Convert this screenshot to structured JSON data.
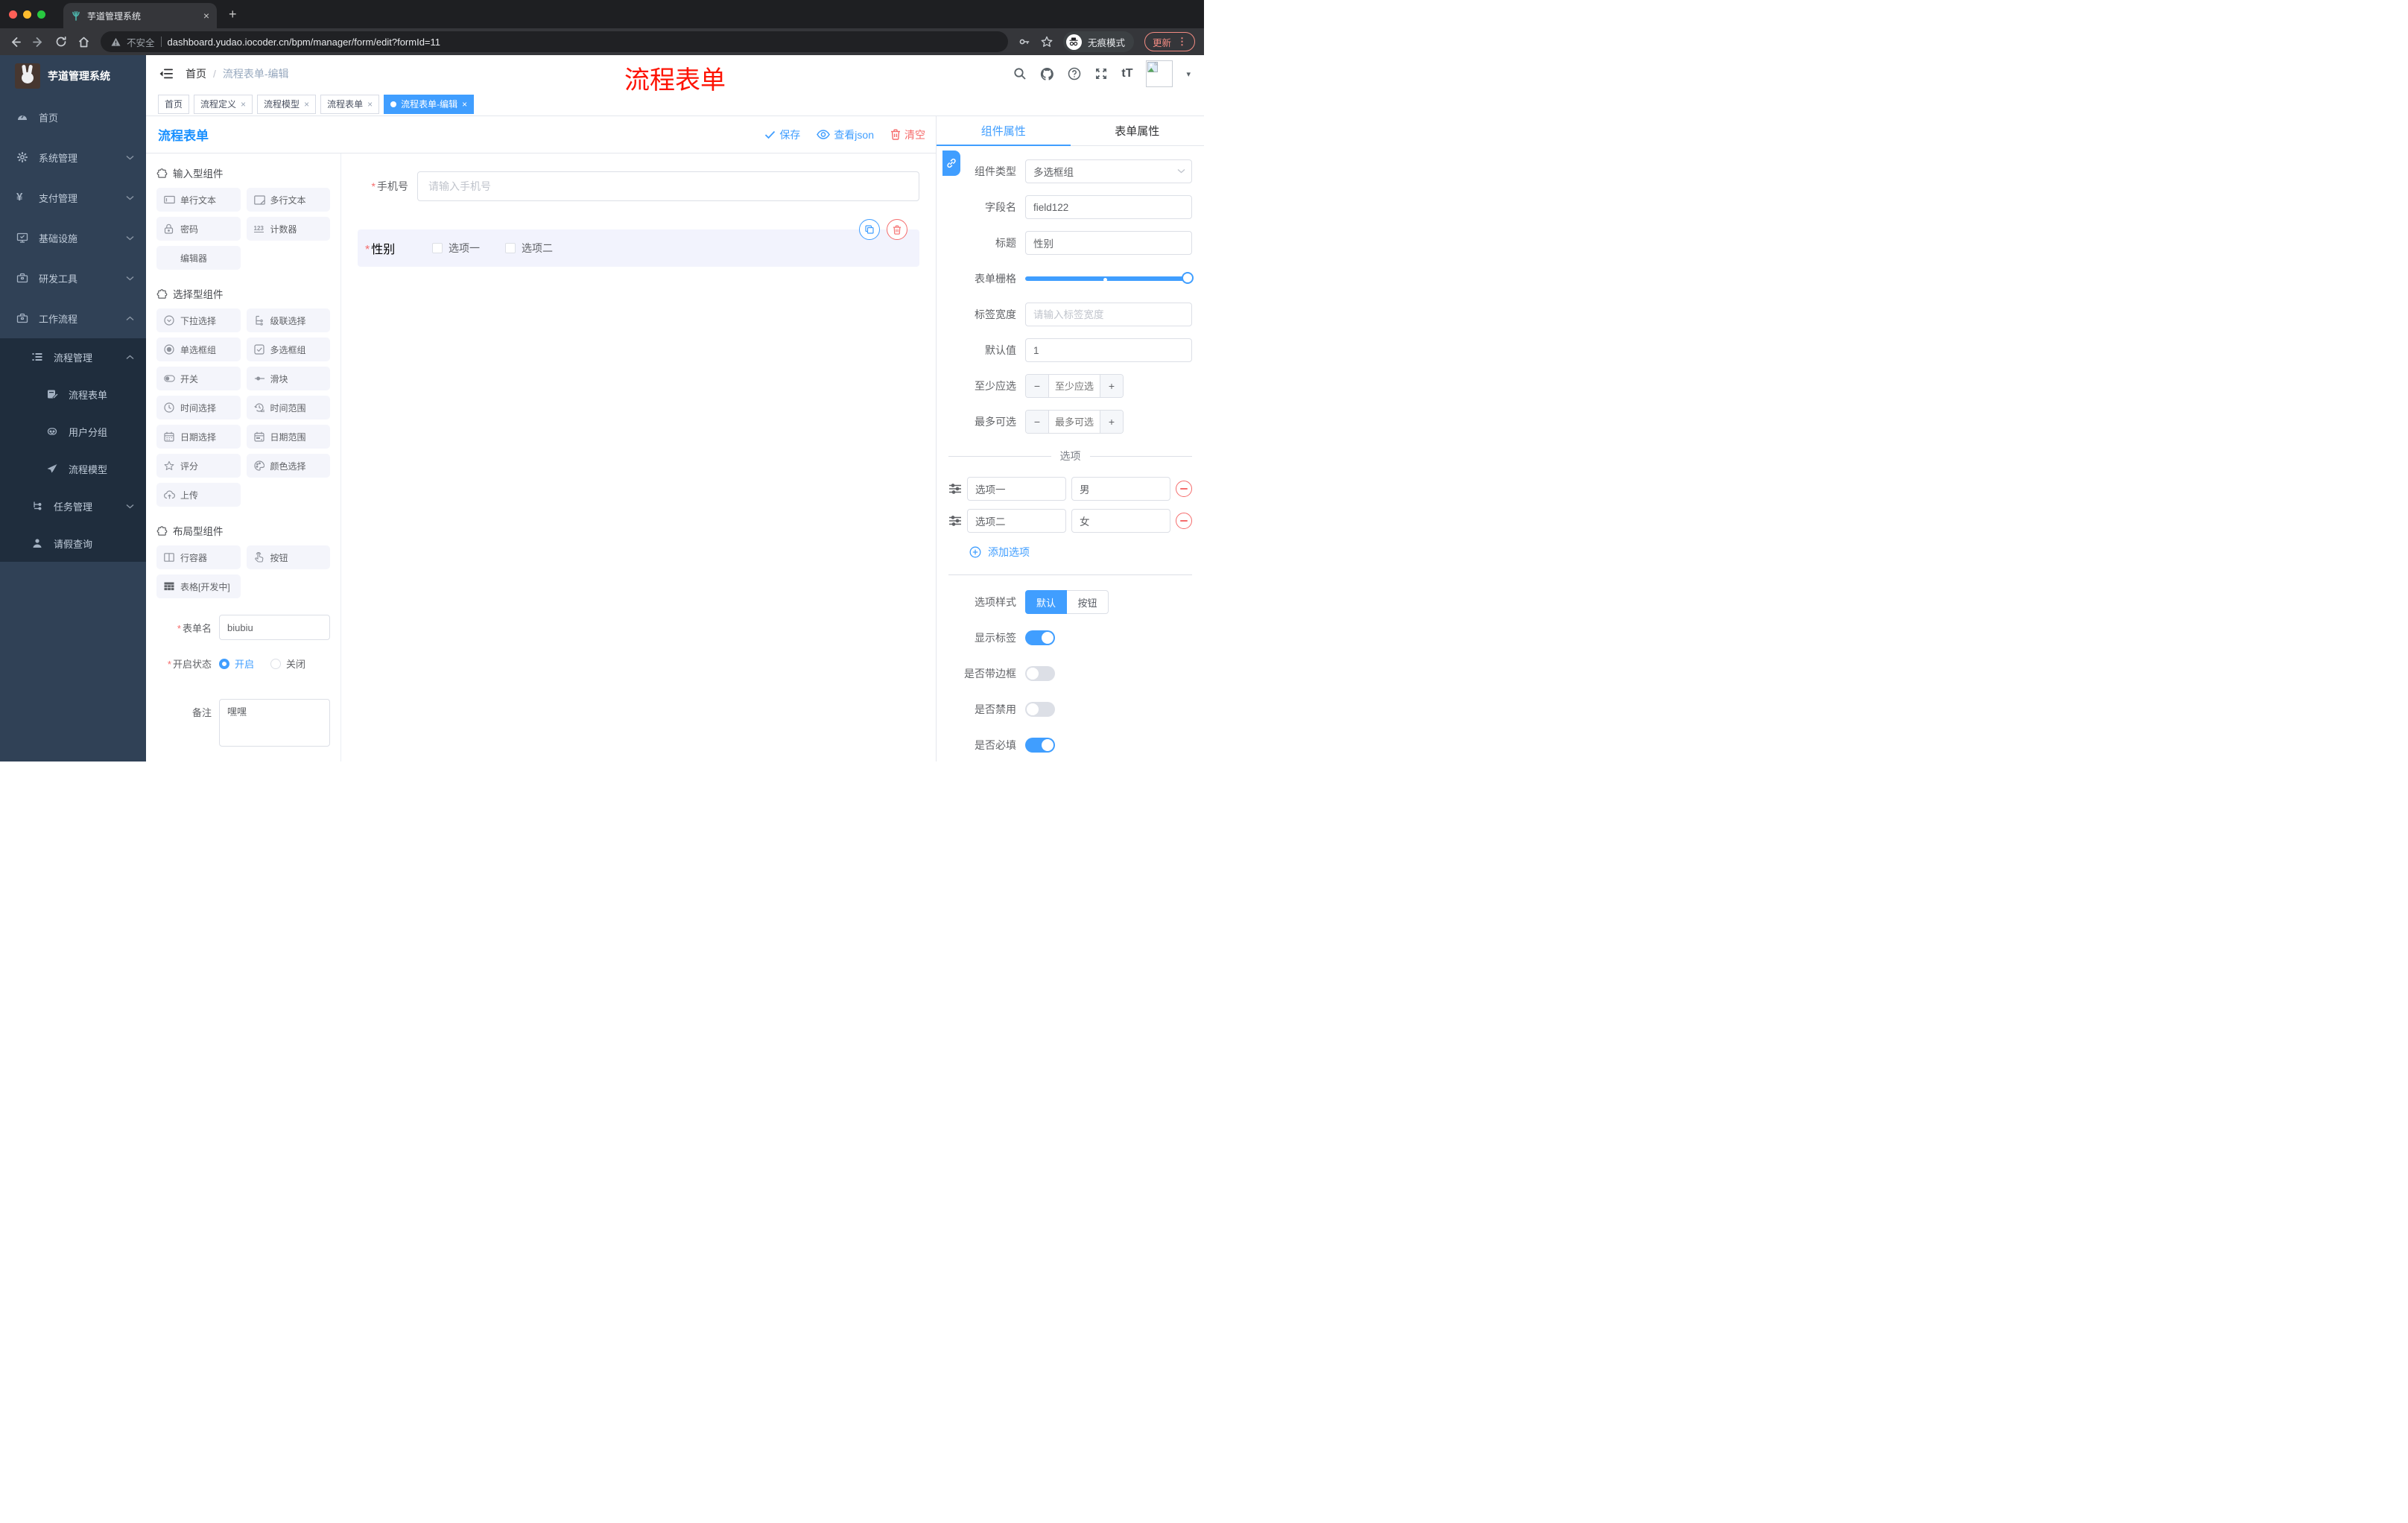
{
  "icons": {
    "close": "×",
    "plus": "+",
    "minus": "−",
    "kebab": "⋮",
    "caret": "▾",
    "sep": "/",
    "required": "*",
    "newtab": "+",
    "font_size": "tT",
    "counter": "123"
  },
  "colors": {
    "accent": "#409eff",
    "danger": "#f56c6c",
    "designer_title_blue": "#1890ff",
    "annotation_red": "#fd1303",
    "sidebar_bg": "#304156",
    "submenu_bg": "#1f2d3d",
    "chrome_dark": "#1e1f22",
    "toolbar_dark": "#35363a",
    "update_salmon": "#f28b82",
    "palette_item_bg": "#f4f5fb",
    "selected_item_bg": "#f2f3fd"
  },
  "browser": {
    "tab_title": "芋道管理系统",
    "security_label": "不安全",
    "url": "dashboard.yudao.iocoder.cn/bpm/manager/form/edit?formId=11",
    "incognito_label": "无痕模式",
    "update_label": "更新"
  },
  "sidebar": {
    "logo_title": "芋道管理系统",
    "items": [
      {
        "label": "首页",
        "icon": "dashboard-icon"
      },
      {
        "label": "系统管理",
        "icon": "gear-icon",
        "chevron": "down"
      },
      {
        "label": "支付管理",
        "icon": "yen-icon",
        "chevron": "down"
      },
      {
        "label": "基础设施",
        "icon": "monitor-icon",
        "chevron": "down"
      },
      {
        "label": "研发工具",
        "icon": "toolbox-icon",
        "chevron": "down"
      },
      {
        "label": "工作流程",
        "icon": "toolbox-icon",
        "chevron": "up"
      }
    ],
    "submenu": [
      {
        "label": "流程管理",
        "icon": "list-tree-icon",
        "chevron": "up",
        "level": 2
      },
      {
        "label": "流程表单",
        "icon": "form-edit-icon",
        "level": 3
      },
      {
        "label": "用户分组",
        "icon": "robot-face-icon",
        "level": 3
      },
      {
        "label": "流程模型",
        "icon": "paper-plane-icon",
        "level": 3
      },
      {
        "label": "任务管理",
        "icon": "branch-icon",
        "chevron": "down",
        "level": 2
      },
      {
        "label": "请假查询",
        "icon": "user-icon",
        "level": 2
      }
    ]
  },
  "header": {
    "breadcrumb": {
      "home": "首页",
      "current": "流程表单-编辑"
    },
    "annotation": "流程表单",
    "icons": [
      "search-icon",
      "github-icon",
      "help-icon",
      "fullscreen-icon",
      "font-size-icon",
      "avatar",
      "caret-down-icon"
    ]
  },
  "tags": [
    {
      "label": "首页",
      "closable": false,
      "active": false
    },
    {
      "label": "流程定义",
      "closable": true,
      "active": false
    },
    {
      "label": "流程模型",
      "closable": true,
      "active": false
    },
    {
      "label": "流程表单",
      "closable": true,
      "active": false
    },
    {
      "label": "流程表单-编辑",
      "closable": true,
      "active": true
    }
  ],
  "designer": {
    "title": "流程表单",
    "save": "保存",
    "view_json": "查看json",
    "clear": "清空"
  },
  "palette": {
    "sections": [
      {
        "title": "输入型组件",
        "icon": "puzzle-icon",
        "items": [
          {
            "label": "单行文本",
            "icon": "input-icon"
          },
          {
            "label": "多行文本",
            "icon": "textarea-icon"
          },
          {
            "label": "密码",
            "icon": "lock-icon"
          },
          {
            "label": "计数器",
            "icon": "counter-123-icon"
          },
          {
            "label": "编辑器",
            "icon": "none"
          }
        ]
      },
      {
        "title": "选择型组件",
        "icon": "puzzle-icon",
        "items": [
          {
            "label": "下拉选择",
            "icon": "select-icon"
          },
          {
            "label": "级联选择",
            "icon": "cascade-icon"
          },
          {
            "label": "单选框组",
            "icon": "radio-icon"
          },
          {
            "label": "多选框组",
            "icon": "checkbox-icon"
          },
          {
            "label": "开关",
            "icon": "switch-icon"
          },
          {
            "label": "滑块",
            "icon": "slider-icon"
          },
          {
            "label": "时间选择",
            "icon": "clock-icon"
          },
          {
            "label": "时间范围",
            "icon": "time-range-icon"
          },
          {
            "label": "日期选择",
            "icon": "calendar-icon"
          },
          {
            "label": "日期范围",
            "icon": "calendar-range-icon"
          },
          {
            "label": "评分",
            "icon": "star-icon"
          },
          {
            "label": "颜色选择",
            "icon": "palette-icon"
          },
          {
            "label": "上传",
            "icon": "upload-cloud-icon"
          }
        ]
      },
      {
        "title": "布局型组件",
        "icon": "puzzle-icon",
        "items": [
          {
            "label": "行容器",
            "icon": "columns-icon"
          },
          {
            "label": "按钮",
            "icon": "pointer-icon"
          },
          {
            "label": "表格[开发中]",
            "icon": "table-icon"
          }
        ]
      }
    ]
  },
  "left_form": {
    "name": {
      "label": "表单名",
      "value": "biubiu"
    },
    "status": {
      "label": "开启状态",
      "on": "开启",
      "off": "关闭",
      "selected": "开启"
    },
    "remark": {
      "label": "备注",
      "value": "嘿嘿"
    }
  },
  "canvas": {
    "phone": {
      "label": "手机号",
      "placeholder": "请输入手机号",
      "required": true
    },
    "gender": {
      "label": "性别",
      "required": true,
      "options": [
        "选项一",
        "选项二"
      ]
    }
  },
  "props": {
    "tabs": {
      "component": "组件属性",
      "form": "表单属性"
    },
    "component_type": {
      "label": "组件类型",
      "value": "多选框组"
    },
    "field_name": {
      "label": "字段名",
      "value": "field122"
    },
    "title": {
      "label": "标题",
      "value": "性别"
    },
    "form_grid": {
      "label": "表单栅格"
    },
    "label_width": {
      "label": "标签宽度",
      "placeholder": "请输入标签宽度"
    },
    "default_value": {
      "label": "默认值",
      "value": "1"
    },
    "min_checked": {
      "label": "至少应选",
      "placeholder": "至少应选"
    },
    "max_checked": {
      "label": "最多可选",
      "placeholder": "最多可选"
    },
    "options_divider": "选项",
    "options": [
      {
        "name": "选项一",
        "value": "男"
      },
      {
        "name": "选项二",
        "value": "女"
      }
    ],
    "add_option": "添加选项",
    "option_style": {
      "label": "选项样式",
      "choice_default": "默认",
      "choice_button": "按钮",
      "active": "默认"
    },
    "switches": [
      {
        "label": "显示标签",
        "on": true
      },
      {
        "label": "是否带边框",
        "on": false
      },
      {
        "label": "是否禁用",
        "on": false
      },
      {
        "label": "是否必填",
        "on": true
      }
    ]
  }
}
